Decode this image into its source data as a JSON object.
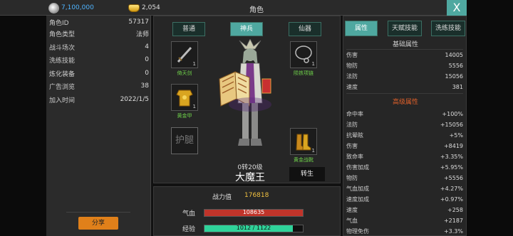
{
  "header": {
    "silver": "7,100,000",
    "gold": "2,054",
    "title": "角色",
    "close": "X"
  },
  "left": {
    "rows": [
      {
        "k": "角色ID",
        "v": "57317"
      },
      {
        "k": "角色类型",
        "v": "法师"
      },
      {
        "k": "战斗场次",
        "v": "4"
      },
      {
        "k": "洗练技能",
        "v": "0"
      },
      {
        "k": "炼化装备",
        "v": "0"
      },
      {
        "k": "广告浏览",
        "v": "38"
      },
      {
        "k": "加入时间",
        "v": "2022/1/5"
      }
    ],
    "share": "分享"
  },
  "center": {
    "tabs": [
      "普通",
      "神兵",
      "仙器"
    ],
    "active_tab": 1,
    "slots": {
      "weapon": {
        "label": "倚天剑",
        "count": "1"
      },
      "armor": {
        "label": "黄金甲",
        "count": "1"
      },
      "legs": {
        "label": "护腿"
      },
      "necklace": {
        "label": "陨铁项链",
        "count": "1"
      },
      "boots": {
        "label": "黄金战靴",
        "count": "1"
      }
    },
    "level": "0转20级",
    "name": "大魔王",
    "rebirth": "转生"
  },
  "bottom": {
    "power_label": "战力值",
    "power_value": "176818",
    "hp_label": "气血",
    "hp_text": "108635",
    "hp_fraction": 1.0,
    "exp_label": "经验",
    "exp_text": "1012 / 1122",
    "exp_fraction": 0.9
  },
  "right": {
    "tabs": [
      "属性",
      "天赋技能",
      "洗练技能"
    ],
    "active_tab": 0,
    "basic_title": "基础属性",
    "basic": [
      {
        "k": "伤害",
        "v": "14005"
      },
      {
        "k": "物防",
        "v": "5556"
      },
      {
        "k": "法防",
        "v": "15056"
      },
      {
        "k": "速度",
        "v": "381"
      }
    ],
    "adv_title": "高级属性",
    "advanced": [
      {
        "k": "命中率",
        "v": "+100%"
      },
      {
        "k": "法防",
        "v": "+15056"
      },
      {
        "k": "抗晕眩",
        "v": "+5%"
      },
      {
        "k": "伤害",
        "v": "+8419"
      },
      {
        "k": "致命率",
        "v": "+3.35%"
      },
      {
        "k": "伤害加成",
        "v": "+5.95%"
      },
      {
        "k": "物防",
        "v": "+5556"
      },
      {
        "k": "气血加成",
        "v": "+4.27%"
      },
      {
        "k": "速度加成",
        "v": "+0.97%"
      },
      {
        "k": "速度",
        "v": "+258"
      },
      {
        "k": "气血",
        "v": "+2187"
      },
      {
        "k": "物理免伤",
        "v": "+3.3%"
      }
    ]
  },
  "colors": {
    "accent": "#4fa8a0",
    "hp": "#c0342a",
    "exp": "#2fd39a",
    "gold_text": "#f0c040",
    "item_label": "#6fd24a",
    "adv_title": "#e0602a"
  }
}
